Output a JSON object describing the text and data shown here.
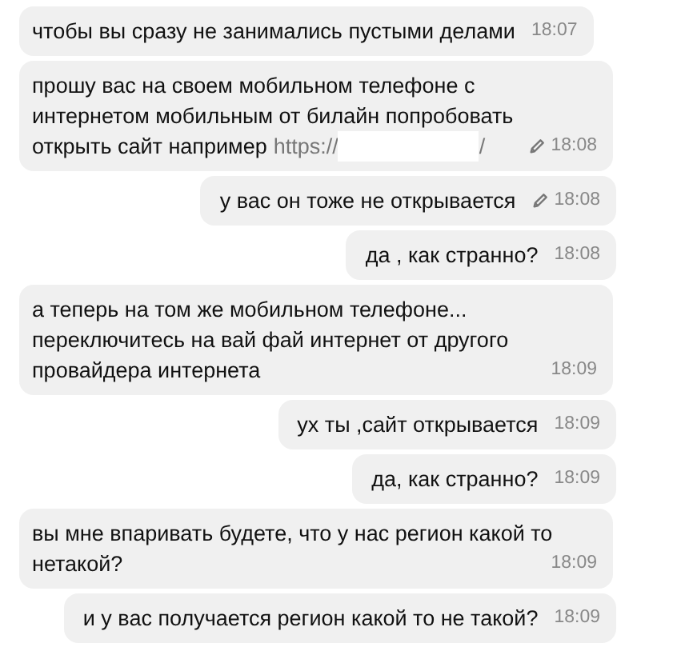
{
  "messages": [
    {
      "outgoing": false,
      "text": "чтобы вы сразу не занимались пустыми делами",
      "edited": false,
      "time": "18:07"
    },
    {
      "outgoing": false,
      "text": "прошу вас на своем мобильном телефоне с интернетом мобильным от билайн попробовать открыть сайт например",
      "link_start": "https://",
      "link_end": "/",
      "edited": true,
      "time": "18:08"
    },
    {
      "outgoing": true,
      "text": "у вас он тоже не открывается",
      "edited": true,
      "time": "18:08"
    },
    {
      "outgoing": true,
      "text": "да , как странно?",
      "edited": false,
      "time": "18:08"
    },
    {
      "outgoing": false,
      "text": "а теперь на том же мобильном телефоне... переключитесь на вай фай интернет от другого провайдера интернета",
      "edited": false,
      "time": "18:09"
    },
    {
      "outgoing": true,
      "text": "ух ты ,сайт открывается",
      "edited": false,
      "time": "18:09"
    },
    {
      "outgoing": true,
      "text": "да, как  странно?",
      "edited": false,
      "time": "18:09"
    },
    {
      "outgoing": false,
      "text": "вы мне впаривать будете, что у нас регион какой то нетакой?",
      "edited": false,
      "time": "18:09"
    },
    {
      "outgoing": true,
      "text": "и у вас получается регион какой то не такой?",
      "edited": false,
      "time": "18:09"
    }
  ]
}
